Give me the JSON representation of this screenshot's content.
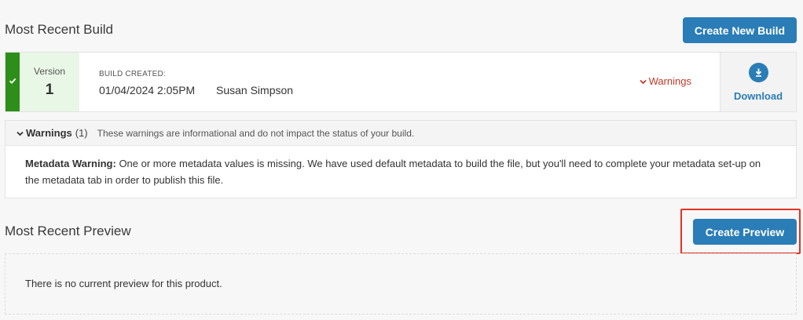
{
  "build_section": {
    "title": "Most Recent Build",
    "create_button": "Create New Build"
  },
  "build": {
    "status_icon": "checkmark-icon",
    "status_color": "#2d8f1a",
    "version_label": "Version",
    "version_number": "1",
    "created_label": "BUILD CREATED:",
    "created_date": "01/04/2024 2:05PM",
    "created_by": "Susan Simpson",
    "warnings_toggle_icon": "chevron-down-icon",
    "warnings_toggle_label": "Warnings",
    "download_icon": "download-icon",
    "download_label": "Download"
  },
  "warnings": {
    "toggle_icon": "chevron-down-icon",
    "title": "Warnings",
    "count": "(1)",
    "description": "These warnings are informational and do not impact the status of your build.",
    "items": [
      {
        "heading": "Metadata Warning:",
        "text": "One or more metadata values is missing. We have used default metadata to build the file, but you'll need to complete your metadata set-up on the metadata tab in order to publish this file."
      }
    ]
  },
  "preview_section": {
    "title": "Most Recent Preview",
    "create_button": "Create Preview",
    "empty_message": "There is no current preview for this product."
  },
  "colors": {
    "accent": "#2a7db6",
    "success": "#2d8f1a",
    "warning": "#c0392b",
    "highlight": "#e53222"
  }
}
